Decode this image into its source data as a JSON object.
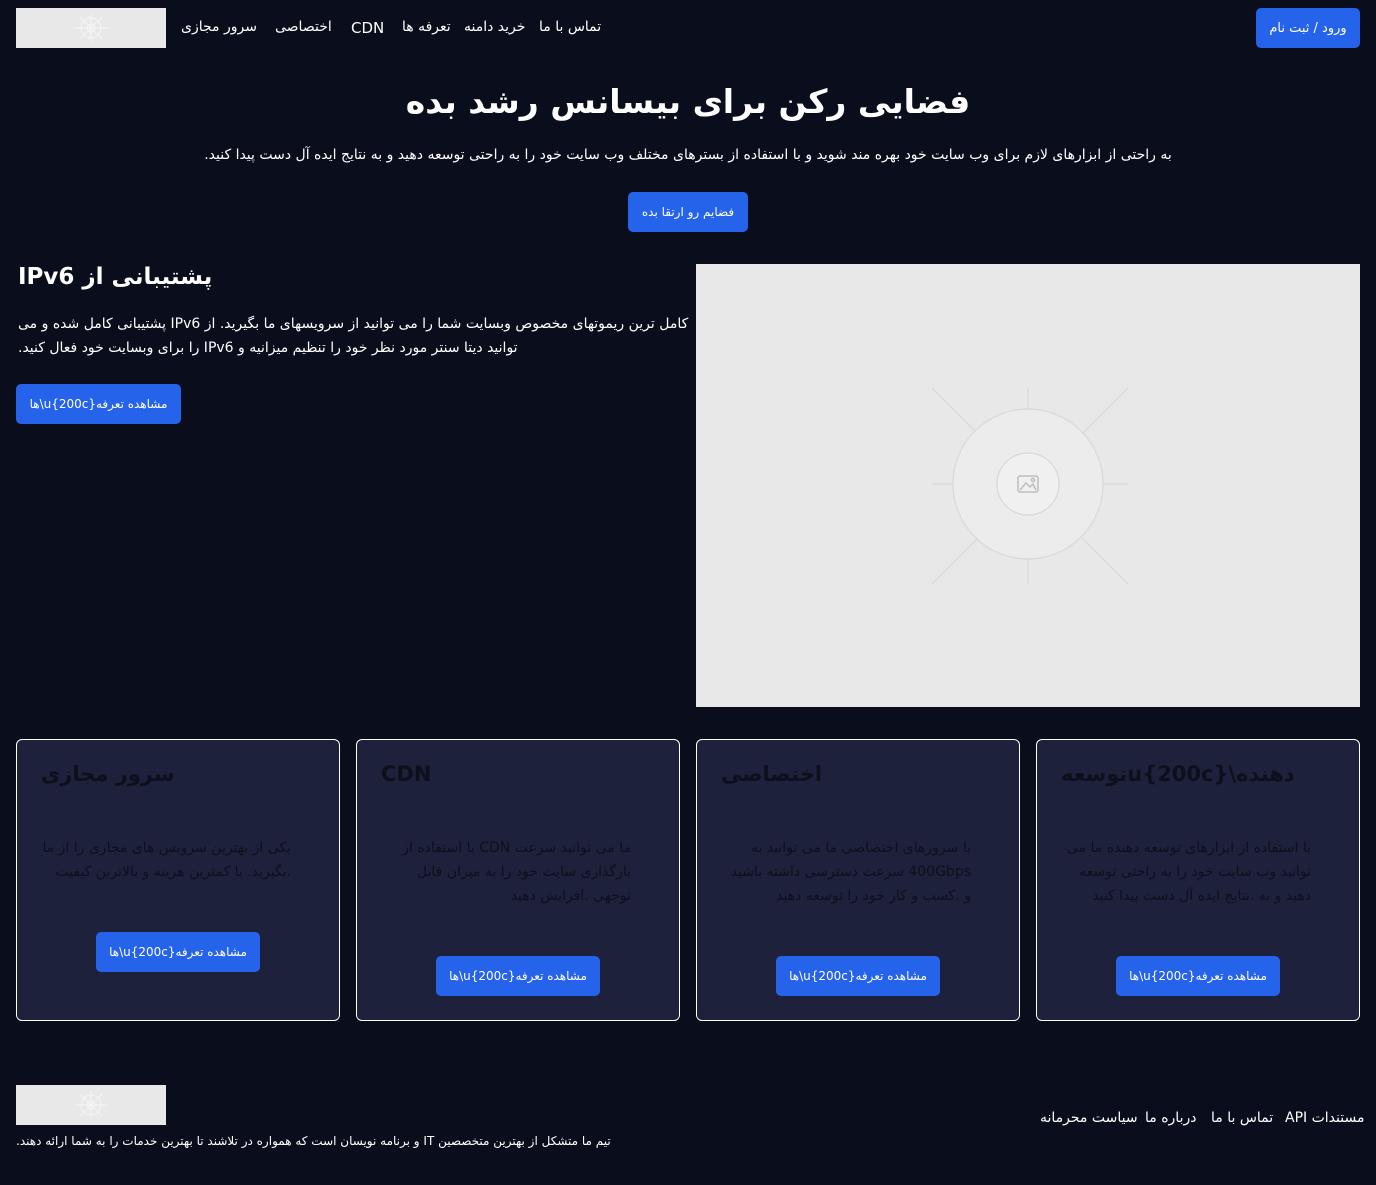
{
  "header": {
    "logo_alt": "logo",
    "nav": [
      {
        "label": "سرور مجازی"
      },
      {
        "label": "اختصاصی"
      },
      {
        "label": "CDN"
      },
      {
        "label": "تعرفه ها"
      },
      {
        "label": "خرید دامنه"
      },
      {
        "label": "تماس با ما"
      }
    ],
    "login_label": "ورود / ثبت نام"
  },
  "hero": {
    "title": "فضایی رکن برای بیسانس رشد بده",
    "subtitle": ".به راحتی از ابزارهای لازم برای وب سایت خود بهره مند شوید و با استفاده از بسترهای مختلف وب سایت خود را به راحتی توسعه دهید و به نتایج ایده آل دست پیدا کنید",
    "cta_label": "فضایم رو ارتقا بده"
  },
  "ipv6": {
    "title": "پشتیبانی از IPv6",
    "text": "پشتیبانی کامل شده و می IPv6 کامل ترین ریموتهای مخصوص وبسایت شما را می توانید از سرویسهای ما بگیرید. از IPv6 توانید دیتا سنتر مورد نظر خود را تنظیم میزانیه و .را برای وبسایت خود فعال کنید",
    "line1": "پشتیبانی کامل شده و می IPv6 کامل ترین ریموتهای مخصوص وبسایت شما را می توانید از سرویسهای ما بگیرید. از",
    "line2": ".را برای وبسایت خود فعال کنید IPv6 توانید دیتا سنتر مورد نظر خود را تنظیم میزانیه و",
    "button_label": "ها\\u{200c}مشاهده تعرفه"
  },
  "cards": [
    {
      "title": "سرور مجازی",
      "text": "یکی از بهترین سرویس های مجازی را از ما .بگیرید. با کمترین هزینه و بالاترین کیفیت",
      "button_label": "ها\\u{200c}مشاهده تعرفه"
    },
    {
      "title": "CDN",
      "text": "ما می توانید سرعت CDN با استفاده از بارگذاری سایت خود را به میزان قابل توجهی .افزایش دهید",
      "button_label": "ها\\u{200c}مشاهده تعرفه"
    },
    {
      "title": "اختصاصی",
      "text": "با سرورهای اختصاصی ما می توانید به 400Gbps سرعت دسترسی داشته باشید و .کسب و کار خود را توسعه دهید",
      "button_label": "ها\\u{200c}مشاهده تعرفه"
    },
    {
      "title": "دهنده\\u{200c}توسعه",
      "text": "با استفاده از ابزارهای توسعه دهنده ما می توانید وب سایت خود را به راحتی توسعه دهید و به .نتایج ایده آل دست پیدا کنید",
      "button_label": "ها\\u{200c}مشاهده تعرفه"
    }
  ],
  "footer": {
    "links": [
      {
        "label": "مستندات API"
      },
      {
        "label": "تماس با ما"
      },
      {
        "label": "درباره ما"
      },
      {
        "label": "سیاست محرمانه"
      }
    ],
    "about": ".و برنامه نویسان است که همواره در تلاشند تا بهترین خدمات را به شما ارائه دهند IT تیم ما متشکل از بهترین متخصصین"
  },
  "colors": {
    "background": "#0a0e1c",
    "accent": "#2563eb",
    "card": "#1e213b",
    "placeholder": "#e8e8e8"
  }
}
